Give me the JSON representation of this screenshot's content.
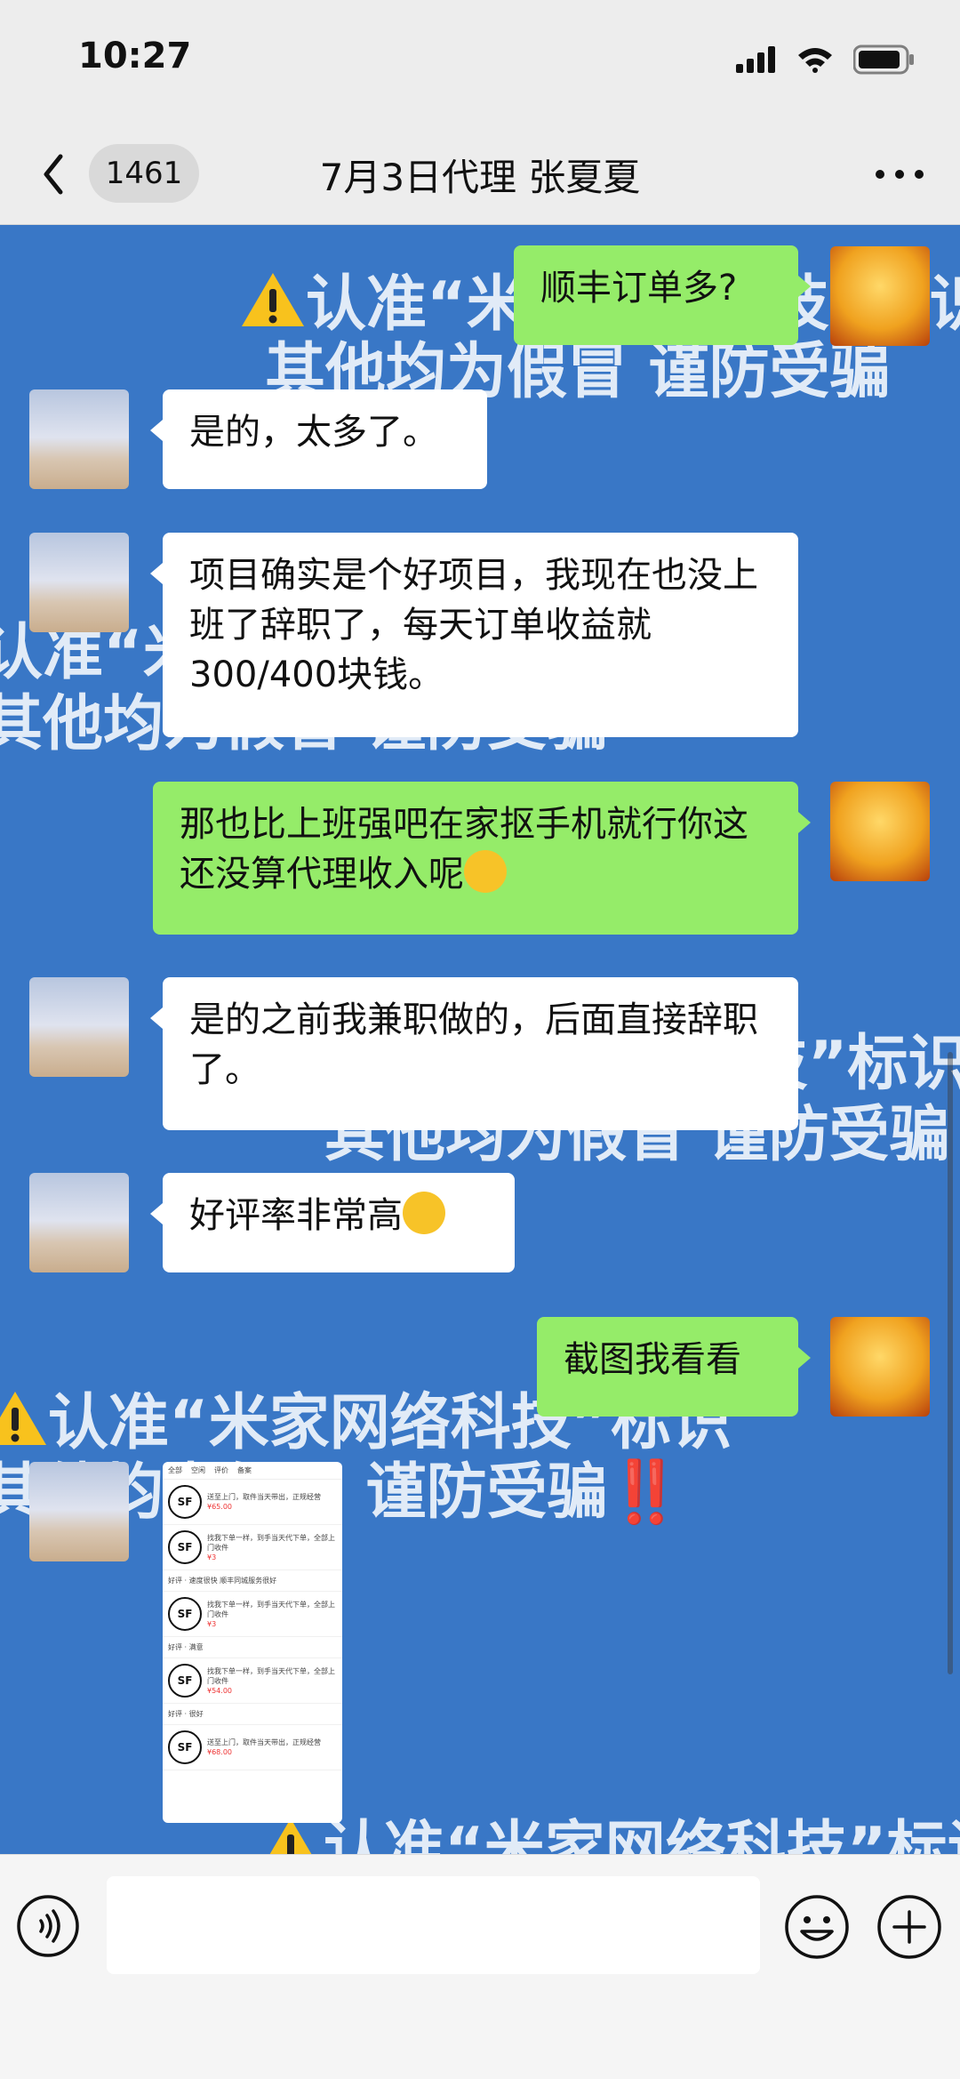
{
  "status_bar": {
    "time": "10:27"
  },
  "header": {
    "back_count": "1461",
    "title": "7月3日代理 张夏夏"
  },
  "watermark": {
    "line1": "认准“米家网络科技”标识",
    "line2": "其他均为假冒 谨防受骗",
    "exclaim": "‼️"
  },
  "messages": [
    {
      "side": "right",
      "text": "顺丰订单多?"
    },
    {
      "side": "left",
      "text": "是的，太多了。"
    },
    {
      "side": "left",
      "text": "项目确实是个好项目，我现在也没上班了辞职了，每天订单收益就300/400块钱。"
    },
    {
      "side": "right",
      "text": "那也比上班强吧在家抠手机就行你这还没算代理收入呢"
    },
    {
      "side": "left",
      "text": "是的之前我兼职做的，后面直接辞职了。"
    },
    {
      "side": "left",
      "text": "好评率非常高"
    },
    {
      "side": "right",
      "text": "截图我看看"
    }
  ],
  "screenshot_image": {
    "tabs": [
      "全部",
      "空闲",
      "评价",
      "备案"
    ],
    "rows": [
      {
        "text": "送至上门，取件当天带出，正规经营",
        "price": "¥65.00"
      },
      {
        "text": "找我下单一样，到手当天代下单，全部上门收件",
        "price": "¥3"
      },
      {
        "text": "好评 · 速度很快 顺丰同城服务很好",
        "price": ""
      },
      {
        "text": "找我下单一样，到手当天代下单，全部上门收件",
        "price": "¥3"
      },
      {
        "text": "好评 · 满意",
        "price": ""
      },
      {
        "text": "找我下单一样，到手当天代下单，全部上门收件",
        "price": "¥54.00"
      },
      {
        "text": "好评 · 很好",
        "price": ""
      },
      {
        "text": "送至上门，取件当天带出，正规经营",
        "price": "¥68.00"
      }
    ],
    "logo_text": "SF"
  },
  "colors": {
    "chat_bg": "#3977c6",
    "bubble_right": "#95ec69",
    "bubble_left": "#ffffff"
  }
}
